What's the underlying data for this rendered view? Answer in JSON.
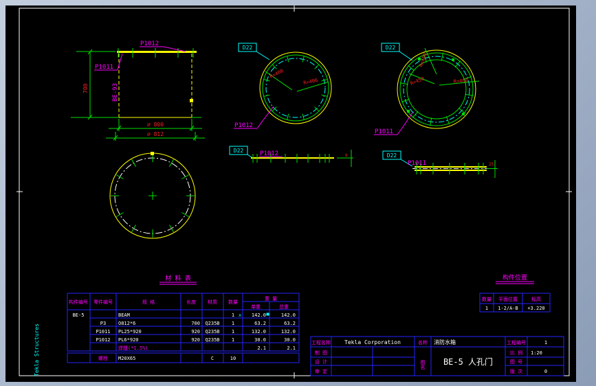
{
  "watermark": "Tekla Structures",
  "drawing": {
    "elevation": {
      "top_plate_label": "P1012",
      "side_label": "P1011",
      "assembly_mark": "BE-93",
      "height_dim": "700",
      "dia_inner": "∅ 800",
      "dia_outer": "∅ 812"
    },
    "cover_plan": {
      "hole_label": "D22",
      "part_label": "P1012",
      "r_inner": "R=400",
      "r_outer": "R=406"
    },
    "flange_plan": {
      "hole_label": "D22",
      "part_label": "P1011",
      "r_top": "R=400",
      "r_left": "R=450",
      "r_right": "R=460"
    },
    "cover_edge": {
      "hole_label": "D22",
      "part_label": "P1012",
      "thickness": "6"
    },
    "flange_edge": {
      "hole_label": "D22",
      "part_label": "P1011",
      "thickness": "25"
    }
  },
  "material_table": {
    "title": "材 料 表",
    "headers": {
      "assembly": "构件编号",
      "part": "零件编号",
      "spec": "规  格",
      "length": "长度",
      "material": "材质",
      "qty": "数量",
      "weight": "重 量",
      "unit": "单重",
      "total": "总重"
    },
    "rows": [
      {
        "assembly": "BE-5",
        "part": "",
        "spec": "BEAM",
        "length": "",
        "material": "",
        "qty": "1",
        "qty_suffix": "x",
        "unit": "142.0",
        "total": "142.0"
      },
      {
        "assembly": "",
        "part": "P3",
        "spec": "O812*6",
        "length": "700",
        "material": "Q235B",
        "qty": "1",
        "unit": "63.2",
        "total": "63.2"
      },
      {
        "assembly": "",
        "part": "P1011",
        "spec": "PL25*920",
        "length": "920",
        "material": "Q235B",
        "qty": "1",
        "unit": "132.0",
        "total": "132.0"
      },
      {
        "assembly": "",
        "part": "P1012",
        "spec": "PL6*920",
        "length": "920",
        "material": "Q235B",
        "qty": "1",
        "unit": "30.0",
        "total": "30.0"
      },
      {
        "assembly": "",
        "part": "",
        "spec": "焊缝(*1.5%)",
        "length": "",
        "material": "",
        "qty": "",
        "unit": "2.1",
        "total": "2.1"
      },
      {
        "assembly": "",
        "part": "螺栓",
        "spec": "M20X65",
        "length": "",
        "material": "C",
        "qty": "10",
        "unit": "",
        "total": ""
      }
    ]
  },
  "position_table": {
    "title": "构件位置",
    "headers": {
      "qty": "数量",
      "plan_location": "平面位置",
      "elevation": "标高"
    },
    "row": {
      "qty": "1",
      "plan_location": "1-2/A-B",
      "elevation": "+3.220"
    }
  },
  "title_block": {
    "project_label": "工程名称",
    "project": "Tekla Corporation",
    "drawn_label": "制 图",
    "designed_label": "设 计",
    "approved_label": "审 定",
    "name_label": "名称",
    "name": "消防水箱",
    "dwg_name_label": "图名",
    "dwg_name": "BE-5 人孔门",
    "project_no_label": "工程编号",
    "project_no": "1",
    "scale_label": "比 例",
    "scale": "1:20",
    "dwg_no_label": "图 号",
    "dwg_no": "",
    "rev_label": "版 次",
    "rev": "0"
  },
  "colors": {
    "geometry_yellow": "#ffff00",
    "geometry_green": "#00e000",
    "label_magenta": "#ff00ff",
    "dimension_red": "#ff2020",
    "hole_cyan": "#00ffff",
    "table_blue": "#2424ff",
    "text_white": "#ffffff",
    "paper_black": "#000000",
    "frame_white": "#ffffff"
  }
}
